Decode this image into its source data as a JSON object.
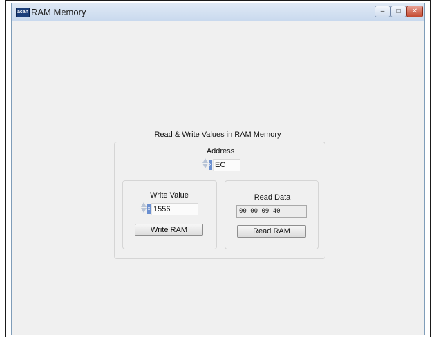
{
  "window": {
    "title": "RAM Memory",
    "icon_text": "acan",
    "controls": {
      "minimize": "–",
      "maximize": "□",
      "close": "✕"
    }
  },
  "panel": {
    "title": "Read & Write Values in RAM Memory",
    "address": {
      "label": "Address",
      "value": "EC",
      "radix": "x"
    },
    "write": {
      "label": "Write Value",
      "value": "1556",
      "radix": "x",
      "button": "Write RAM"
    },
    "read": {
      "label": "Read Data",
      "value": "00 00 09 40",
      "button": "Read RAM"
    }
  }
}
